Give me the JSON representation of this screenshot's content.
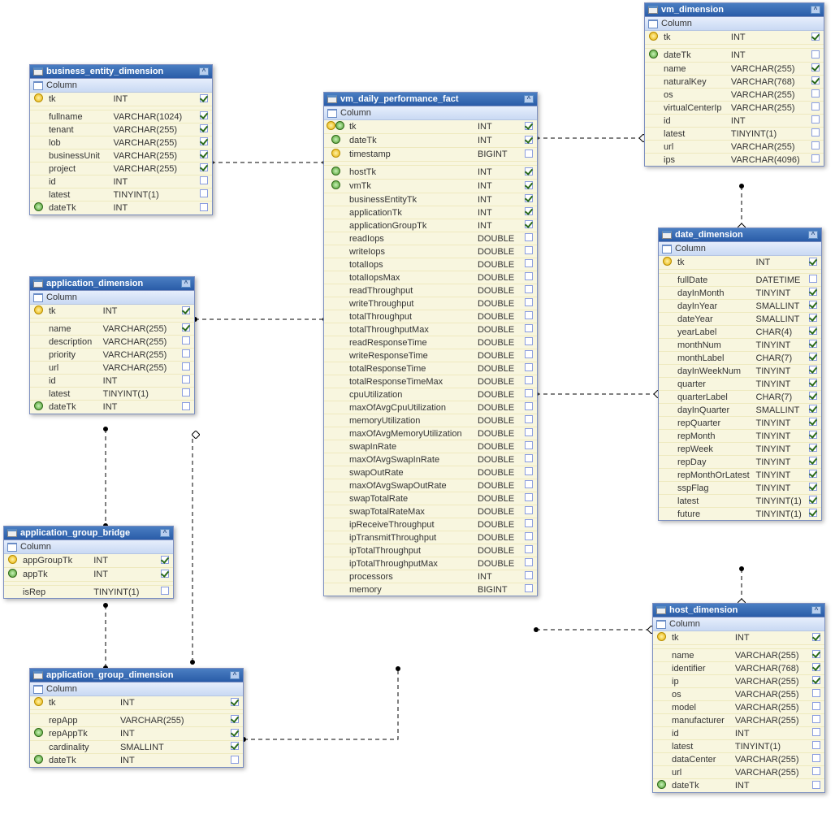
{
  "column_label": "Column",
  "entities": {
    "business_entity_dimension": {
      "title": "business_entity_dimension",
      "columns": [
        {
          "key": "pk",
          "name": "tk",
          "type": "INT",
          "chk": true
        },
        {
          "sep": true
        },
        {
          "name": "fullname",
          "type": "VARCHAR(1024)",
          "chk": true
        },
        {
          "name": "tenant",
          "type": "VARCHAR(255)",
          "chk": true
        },
        {
          "name": "lob",
          "type": "VARCHAR(255)",
          "chk": true
        },
        {
          "name": "businessUnit",
          "type": "VARCHAR(255)",
          "chk": true
        },
        {
          "name": "project",
          "type": "VARCHAR(255)",
          "chk": true
        },
        {
          "name": "id",
          "type": "INT",
          "chk": false
        },
        {
          "name": "latest",
          "type": "TINYINT(1)",
          "chk": false
        },
        {
          "key": "fk",
          "name": "dateTk",
          "type": "INT",
          "chk": false
        }
      ]
    },
    "application_dimension": {
      "title": "application_dimension",
      "columns": [
        {
          "key": "pk",
          "name": "tk",
          "type": "INT",
          "chk": true
        },
        {
          "sep": true
        },
        {
          "name": "name",
          "type": "VARCHAR(255)",
          "chk": true
        },
        {
          "name": "description",
          "type": "VARCHAR(255)",
          "chk": false
        },
        {
          "name": "priority",
          "type": "VARCHAR(255)",
          "chk": false
        },
        {
          "name": "url",
          "type": "VARCHAR(255)",
          "chk": false
        },
        {
          "name": "id",
          "type": "INT",
          "chk": false
        },
        {
          "name": "latest",
          "type": "TINYINT(1)",
          "chk": false
        },
        {
          "key": "fk",
          "name": "dateTk",
          "type": "INT",
          "chk": false
        }
      ]
    },
    "application_group_bridge": {
      "title": "application_group_bridge",
      "columns": [
        {
          "key": "pk",
          "name": "appGroupTk",
          "type": "INT",
          "chk": true
        },
        {
          "key": "fk",
          "name": "appTk",
          "type": "INT",
          "chk": true
        },
        {
          "sep": true
        },
        {
          "name": "isRep",
          "type": "TINYINT(1)",
          "chk": false
        }
      ]
    },
    "application_group_dimension": {
      "title": "application_group_dimension",
      "columns": [
        {
          "key": "pk",
          "name": "tk",
          "type": "INT",
          "chk": true
        },
        {
          "sep": true
        },
        {
          "name": "repApp",
          "type": "VARCHAR(255)",
          "chk": true
        },
        {
          "key": "fk",
          "name": "repAppTk",
          "type": "INT",
          "chk": true
        },
        {
          "name": "cardinality",
          "type": "SMALLINT",
          "chk": true
        },
        {
          "key": "fk",
          "name": "dateTk",
          "type": "INT",
          "chk": false
        }
      ]
    },
    "vm_daily_performance_fact": {
      "title": "vm_daily_performance_fact",
      "columns": [
        {
          "key": "pk",
          "key2": "fk",
          "name": "tk",
          "type": "INT",
          "chk": true
        },
        {
          "key": "fk",
          "name": "dateTk",
          "type": "INT",
          "chk": true
        },
        {
          "key": "pk",
          "name": "timestamp",
          "type": "BIGINT",
          "chk": false
        },
        {
          "sep": true
        },
        {
          "key": "fk",
          "name": "hostTk",
          "type": "INT",
          "chk": true
        },
        {
          "key": "fk",
          "name": "vmTk",
          "type": "INT",
          "chk": true
        },
        {
          "name": "businessEntityTk",
          "type": "INT",
          "chk": true
        },
        {
          "name": "applicationTk",
          "type": "INT",
          "chk": true
        },
        {
          "name": "applicationGroupTk",
          "type": "INT",
          "chk": true
        },
        {
          "name": "readIops",
          "type": "DOUBLE",
          "chk": false
        },
        {
          "name": "writeIops",
          "type": "DOUBLE",
          "chk": false
        },
        {
          "name": "totalIops",
          "type": "DOUBLE",
          "chk": false
        },
        {
          "name": "totalIopsMax",
          "type": "DOUBLE",
          "chk": false
        },
        {
          "name": "readThroughput",
          "type": "DOUBLE",
          "chk": false
        },
        {
          "name": "writeThroughput",
          "type": "DOUBLE",
          "chk": false
        },
        {
          "name": "totalThroughput",
          "type": "DOUBLE",
          "chk": false
        },
        {
          "name": "totalThroughputMax",
          "type": "DOUBLE",
          "chk": false
        },
        {
          "name": "readResponseTime",
          "type": "DOUBLE",
          "chk": false
        },
        {
          "name": "writeResponseTime",
          "type": "DOUBLE",
          "chk": false
        },
        {
          "name": "totalResponseTime",
          "type": "DOUBLE",
          "chk": false
        },
        {
          "name": "totalResponseTimeMax",
          "type": "DOUBLE",
          "chk": false
        },
        {
          "name": "cpuUtilization",
          "type": "DOUBLE",
          "chk": false
        },
        {
          "name": "maxOfAvgCpuUtilization",
          "type": "DOUBLE",
          "chk": false
        },
        {
          "name": "memoryUtilization",
          "type": "DOUBLE",
          "chk": false
        },
        {
          "name": "maxOfAvgMemoryUtilization",
          "type": "DOUBLE",
          "chk": false
        },
        {
          "name": "swapInRate",
          "type": "DOUBLE",
          "chk": false
        },
        {
          "name": "maxOfAvgSwapInRate",
          "type": "DOUBLE",
          "chk": false
        },
        {
          "name": "swapOutRate",
          "type": "DOUBLE",
          "chk": false
        },
        {
          "name": "maxOfAvgSwapOutRate",
          "type": "DOUBLE",
          "chk": false
        },
        {
          "name": "swapTotalRate",
          "type": "DOUBLE",
          "chk": false
        },
        {
          "name": "swapTotalRateMax",
          "type": "DOUBLE",
          "chk": false
        },
        {
          "name": "ipReceiveThroughput",
          "type": "DOUBLE",
          "chk": false
        },
        {
          "name": "ipTransmitThroughput",
          "type": "DOUBLE",
          "chk": false
        },
        {
          "name": "ipTotalThroughput",
          "type": "DOUBLE",
          "chk": false
        },
        {
          "name": "ipTotalThroughputMax",
          "type": "DOUBLE",
          "chk": false
        },
        {
          "name": "processors",
          "type": "INT",
          "chk": false
        },
        {
          "name": "memory",
          "type": "BIGINT",
          "chk": false
        }
      ]
    },
    "vm_dimension": {
      "title": "vm_dimension",
      "columns": [
        {
          "key": "pk",
          "name": "tk",
          "type": "INT",
          "chk": true
        },
        {
          "sep": true
        },
        {
          "key": "fk",
          "name": "dateTk",
          "type": "INT",
          "chk": false
        },
        {
          "name": "name",
          "type": "VARCHAR(255)",
          "chk": true
        },
        {
          "name": "naturalKey",
          "type": "VARCHAR(768)",
          "chk": true
        },
        {
          "name": "os",
          "type": "VARCHAR(255)",
          "chk": false
        },
        {
          "name": "virtualCenterIp",
          "type": "VARCHAR(255)",
          "chk": false
        },
        {
          "name": "id",
          "type": "INT",
          "chk": false
        },
        {
          "name": "latest",
          "type": "TINYINT(1)",
          "chk": false
        },
        {
          "name": "url",
          "type": "VARCHAR(255)",
          "chk": false
        },
        {
          "name": "ips",
          "type": "VARCHAR(4096)",
          "chk": false
        }
      ]
    },
    "date_dimension": {
      "title": "date_dimension",
      "columns": [
        {
          "key": "pk",
          "name": "tk",
          "type": "INT",
          "chk": true
        },
        {
          "sep": true
        },
        {
          "name": "fullDate",
          "type": "DATETIME",
          "chk": false
        },
        {
          "name": "dayInMonth",
          "type": "TINYINT",
          "chk": true
        },
        {
          "name": "dayInYear",
          "type": "SMALLINT",
          "chk": true
        },
        {
          "name": "dateYear",
          "type": "SMALLINT",
          "chk": true
        },
        {
          "name": "yearLabel",
          "type": "CHAR(4)",
          "chk": true
        },
        {
          "name": "monthNum",
          "type": "TINYINT",
          "chk": true
        },
        {
          "name": "monthLabel",
          "type": "CHAR(7)",
          "chk": true
        },
        {
          "name": "dayInWeekNum",
          "type": "TINYINT",
          "chk": true
        },
        {
          "name": "quarter",
          "type": "TINYINT",
          "chk": true
        },
        {
          "name": "quarterLabel",
          "type": "CHAR(7)",
          "chk": true
        },
        {
          "name": "dayInQuarter",
          "type": "SMALLINT",
          "chk": true
        },
        {
          "name": "repQuarter",
          "type": "TINYINT",
          "chk": true
        },
        {
          "name": "repMonth",
          "type": "TINYINT",
          "chk": true
        },
        {
          "name": "repWeek",
          "type": "TINYINT",
          "chk": true
        },
        {
          "name": "repDay",
          "type": "TINYINT",
          "chk": true
        },
        {
          "name": "repMonthOrLatest",
          "type": "TINYINT",
          "chk": true
        },
        {
          "name": "sspFlag",
          "type": "TINYINT",
          "chk": true
        },
        {
          "name": "latest",
          "type": "TINYINT(1)",
          "chk": true
        },
        {
          "name": "future",
          "type": "TINYINT(1)",
          "chk": true
        }
      ]
    },
    "host_dimension": {
      "title": "host_dimension",
      "columns": [
        {
          "key": "pk",
          "name": "tk",
          "type": "INT",
          "chk": true
        },
        {
          "sep": true
        },
        {
          "name": "name",
          "type": "VARCHAR(255)",
          "chk": true
        },
        {
          "name": "identifier",
          "type": "VARCHAR(768)",
          "chk": true
        },
        {
          "name": "ip",
          "type": "VARCHAR(255)",
          "chk": true
        },
        {
          "name": "os",
          "type": "VARCHAR(255)",
          "chk": false
        },
        {
          "name": "model",
          "type": "VARCHAR(255)",
          "chk": false
        },
        {
          "name": "manufacturer",
          "type": "VARCHAR(255)",
          "chk": false
        },
        {
          "name": "id",
          "type": "INT",
          "chk": false
        },
        {
          "name": "latest",
          "type": "TINYINT(1)",
          "chk": false
        },
        {
          "name": "dataCenter",
          "type": "VARCHAR(255)",
          "chk": false
        },
        {
          "name": "url",
          "type": "VARCHAR(255)",
          "chk": false
        },
        {
          "key": "fk",
          "name": "dateTk",
          "type": "INT",
          "chk": false
        }
      ]
    }
  }
}
